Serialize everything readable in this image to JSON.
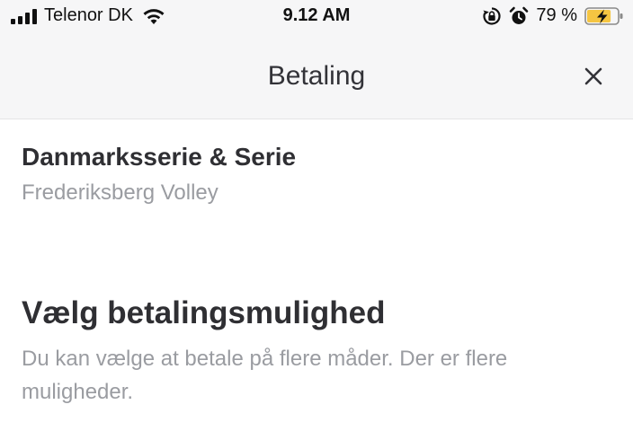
{
  "status_bar": {
    "carrier": "Telenor DK",
    "time": "9.12 AM",
    "battery_percent": "79 %",
    "battery_level": 0.79,
    "icons": [
      "signal-icon",
      "wifi-icon",
      "rotation-lock-icon",
      "alarm-icon",
      "battery-charging-icon"
    ]
  },
  "nav": {
    "title": "Betaling",
    "close_icon": "close-icon"
  },
  "team": {
    "name": "Danmarksserie & Serie",
    "club": "Frederiksberg Volley"
  },
  "payment_section": {
    "heading": "Vælg betalingsmulighed",
    "description": "Du kan vælge at betale på flere måder. Der er flere muligheder."
  },
  "colors": {
    "background": "#ffffff",
    "bar_background": "#f6f6f7",
    "primary_text": "#2f2f33",
    "secondary_text": "#9a9ca1",
    "battery_fill": "#f5c542"
  }
}
